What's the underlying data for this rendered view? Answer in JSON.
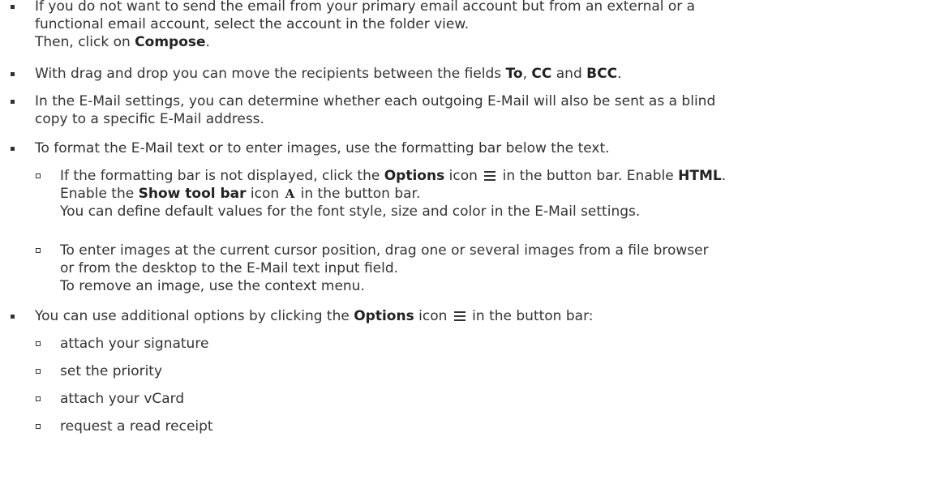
{
  "list": {
    "item1": {
      "line1": "If you do not want to send the email from your primary email account but from an external or a",
      "line2": "functional email account, select the account in the folder view.",
      "line3_pre": "Then, click on ",
      "line3_bold": "Compose",
      "line3_post": "."
    },
    "item2": {
      "pre": "With drag and drop you can move the recipients between the fields ",
      "to": "To",
      "sep1": ", ",
      "cc": "CC",
      "sep2": " and ",
      "bcc": "BCC",
      "post": "."
    },
    "item3": {
      "line1": "In the E-Mail settings, you can determine whether each outgoing E-Mail will also be sent as a blind",
      "line2": "copy to a specific E-Mail address."
    },
    "item4": {
      "text": "To format the E-Mail text or to enter images, use the formatting bar below the text.",
      "sub1": {
        "pre": "If the formatting bar is not displayed, click the ",
        "options": "Options",
        "mid1": " icon ",
        "mid2": " in the button bar. Enable ",
        "html": "HTML",
        "post1": ".",
        "line2_pre": "Enable the ",
        "show_tool_bar": "Show tool bar",
        "line2_mid": " icon ",
        "fmt_icon_glyph": "A",
        "line2_post": " in the button bar.",
        "line3": "You can define default values for the font style, size and color in the E-Mail settings."
      },
      "sub2": {
        "line1": "To enter images at the current cursor position, drag one or several images from a file browser",
        "line2": "or from the desktop to the E-Mail text input field.",
        "line3": "To remove an image, use the context menu."
      }
    },
    "item5": {
      "pre": "You can use additional options by clicking the ",
      "options": "Options",
      "mid": " icon ",
      "post": " in the button bar:",
      "subs": [
        "attach your signature",
        "set the priority",
        "attach your vCard",
        "request a read receipt"
      ]
    }
  },
  "icons": {
    "options": "hamburger-menu-icon",
    "format": "format-text-icon"
  },
  "colors": {
    "text": "#333333",
    "bold": "#222222",
    "background": "#ffffff"
  }
}
